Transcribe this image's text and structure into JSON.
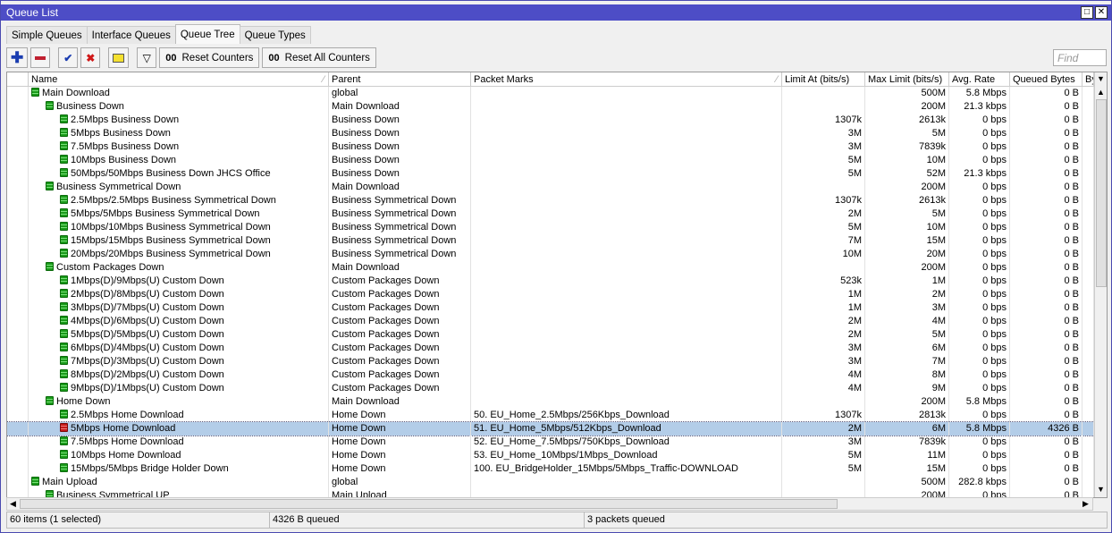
{
  "window": {
    "title": "Queue List",
    "buttons": [
      "restore",
      "close"
    ]
  },
  "tabs": [
    {
      "label": "Simple Queues"
    },
    {
      "label": "Interface Queues"
    },
    {
      "label": "Queue Tree",
      "active": true
    },
    {
      "label": "Queue Types"
    }
  ],
  "toolbar": {
    "reset_counters": "Reset Counters",
    "reset_all_counters": "Reset All Counters",
    "counter_glyph": "00",
    "find_placeholder": "Find"
  },
  "columns": [
    "Name",
    "Parent",
    "Packet Marks",
    "Limit At (bits/s)",
    "Max Limit (bits/s)",
    "Avg. Rate",
    "Queued Bytes",
    "By"
  ],
  "rows": [
    {
      "level": 0,
      "name": "Main Download",
      "parent": "global",
      "marks": "",
      "limit": "",
      "max": "500M",
      "avg": "5.8 Mbps",
      "queued": "0 B"
    },
    {
      "level": 1,
      "name": "Business Down",
      "parent": "Main Download",
      "marks": "",
      "limit": "",
      "max": "200M",
      "avg": "21.3 kbps",
      "queued": "0 B"
    },
    {
      "level": 2,
      "name": "2.5Mbps Business Down",
      "parent": "Business Down",
      "marks": "",
      "limit": "1307k",
      "max": "2613k",
      "avg": "0 bps",
      "queued": "0 B"
    },
    {
      "level": 2,
      "name": "5Mbps Business Down",
      "parent": "Business Down",
      "marks": "",
      "limit": "3M",
      "max": "5M",
      "avg": "0 bps",
      "queued": "0 B"
    },
    {
      "level": 2,
      "name": "7.5Mbps Business Down",
      "parent": "Business Down",
      "marks": "",
      "limit": "3M",
      "max": "7839k",
      "avg": "0 bps",
      "queued": "0 B"
    },
    {
      "level": 2,
      "name": "10Mbps Business Down",
      "parent": "Business Down",
      "marks": "",
      "limit": "5M",
      "max": "10M",
      "avg": "0 bps",
      "queued": "0 B"
    },
    {
      "level": 2,
      "name": "50Mbps/50Mbps Business Down JHCS Office",
      "parent": "Business Down",
      "marks": "",
      "limit": "5M",
      "max": "52M",
      "avg": "21.3 kbps",
      "queued": "0 B"
    },
    {
      "level": 1,
      "name": "Business Symmetrical Down",
      "parent": "Main Download",
      "marks": "",
      "limit": "",
      "max": "200M",
      "avg": "0 bps",
      "queued": "0 B"
    },
    {
      "level": 2,
      "name": "2.5Mbps/2.5Mbps Business Symmetrical Down",
      "parent": "Business Symmetrical Down",
      "marks": "",
      "limit": "1307k",
      "max": "2613k",
      "avg": "0 bps",
      "queued": "0 B"
    },
    {
      "level": 2,
      "name": "5Mbps/5Mbps Business Symmetrical Down",
      "parent": "Business Symmetrical Down",
      "marks": "",
      "limit": "2M",
      "max": "5M",
      "avg": "0 bps",
      "queued": "0 B"
    },
    {
      "level": 2,
      "name": "10Mbps/10Mbps  Business Symmetrical Down",
      "parent": "Business Symmetrical Down",
      "marks": "",
      "limit": "5M",
      "max": "10M",
      "avg": "0 bps",
      "queued": "0 B"
    },
    {
      "level": 2,
      "name": "15Mbps/15Mbps Business Symmetrical Down",
      "parent": "Business Symmetrical Down",
      "marks": "",
      "limit": "7M",
      "max": "15M",
      "avg": "0 bps",
      "queued": "0 B"
    },
    {
      "level": 2,
      "name": "20Mbps/20Mbps Business Symmetrical Down",
      "parent": "Business Symmetrical Down",
      "marks": "",
      "limit": "10M",
      "max": "20M",
      "avg": "0 bps",
      "queued": "0 B"
    },
    {
      "level": 1,
      "name": "Custom Packages Down",
      "parent": "Main Download",
      "marks": "",
      "limit": "",
      "max": "200M",
      "avg": "0 bps",
      "queued": "0 B"
    },
    {
      "level": 2,
      "name": "1Mbps(D)/9Mbps(U) Custom Down",
      "parent": "Custom Packages Down",
      "marks": "",
      "limit": "523k",
      "max": "1M",
      "avg": "0 bps",
      "queued": "0 B"
    },
    {
      "level": 2,
      "name": "2Mbps(D)/8Mbps(U) Custom Down",
      "parent": "Custom Packages Down",
      "marks": "",
      "limit": "1M",
      "max": "2M",
      "avg": "0 bps",
      "queued": "0 B"
    },
    {
      "level": 2,
      "name": "3Mbps(D)/7Mbps(U) Custom Down",
      "parent": "Custom Packages Down",
      "marks": "",
      "limit": "1M",
      "max": "3M",
      "avg": "0 bps",
      "queued": "0 B"
    },
    {
      "level": 2,
      "name": "4Mbps(D)/6Mbps(U) Custom Down",
      "parent": "Custom Packages Down",
      "marks": "",
      "limit": "2M",
      "max": "4M",
      "avg": "0 bps",
      "queued": "0 B"
    },
    {
      "level": 2,
      "name": "5Mbps(D)/5Mbps(U) Custom Down",
      "parent": "Custom Packages Down",
      "marks": "",
      "limit": "2M",
      "max": "5M",
      "avg": "0 bps",
      "queued": "0 B"
    },
    {
      "level": 2,
      "name": "6Mbps(D)/4Mbps(U) Custom Down",
      "parent": "Custom Packages Down",
      "marks": "",
      "limit": "3M",
      "max": "6M",
      "avg": "0 bps",
      "queued": "0 B"
    },
    {
      "level": 2,
      "name": "7Mbps(D)/3Mbps(U) Custom Down",
      "parent": "Custom Packages Down",
      "marks": "",
      "limit": "3M",
      "max": "7M",
      "avg": "0 bps",
      "queued": "0 B"
    },
    {
      "level": 2,
      "name": "8Mbps(D)/2Mbps(U) Custom Down",
      "parent": "Custom Packages Down",
      "marks": "",
      "limit": "4M",
      "max": "8M",
      "avg": "0 bps",
      "queued": "0 B"
    },
    {
      "level": 2,
      "name": "9Mbps(D)/1Mbps(U) Custom Down",
      "parent": "Custom Packages Down",
      "marks": "",
      "limit": "4M",
      "max": "9M",
      "avg": "0 bps",
      "queued": "0 B"
    },
    {
      "level": 1,
      "name": "Home Down",
      "parent": "Main Download",
      "marks": "",
      "limit": "",
      "max": "200M",
      "avg": "5.8 Mbps",
      "queued": "0 B"
    },
    {
      "level": 2,
      "name": "2.5Mbps Home Download",
      "parent": "Home Down",
      "marks": "50. EU_Home_2.5Mbps/256Kbps_Download",
      "limit": "1307k",
      "max": "2813k",
      "avg": "0 bps",
      "queued": "0 B"
    },
    {
      "level": 2,
      "name": "5Mbps Home Download",
      "parent": "Home Down",
      "marks": "51. EU_Home_5Mbps/512Kbps_Download",
      "limit": "2M",
      "max": "6M",
      "avg": "5.8 Mbps",
      "queued": "4326 B",
      "selected": true,
      "status": "red"
    },
    {
      "level": 2,
      "name": "7.5Mbps Home Download",
      "parent": "Home Down",
      "marks": "52. EU_Home_7.5Mbps/750Kbps_Download",
      "limit": "3M",
      "max": "7839k",
      "avg": "0 bps",
      "queued": "0 B"
    },
    {
      "level": 2,
      "name": "10Mbps Home Download",
      "parent": "Home Down",
      "marks": "53. EU_Home_10Mbps/1Mbps_Download",
      "limit": "5M",
      "max": "11M",
      "avg": "0 bps",
      "queued": "0 B"
    },
    {
      "level": 2,
      "name": "15Mbps/5Mbps Bridge Holder Down",
      "parent": "Home Down",
      "marks": "100. EU_BridgeHolder_15Mbps/5Mbps_Traffic-DOWNLOAD",
      "limit": "5M",
      "max": "15M",
      "avg": "0 bps",
      "queued": "0 B"
    },
    {
      "level": 0,
      "name": "Main Upload",
      "parent": "global",
      "marks": "",
      "limit": "",
      "max": "500M",
      "avg": "282.8 kbps",
      "queued": "0 B"
    },
    {
      "level": 1,
      "name": "Business Symmetrical UP",
      "parent": "Main Upload",
      "marks": "",
      "limit": "",
      "max": "200M",
      "avg": "0 bps",
      "queued": "0 B"
    }
  ],
  "status": {
    "items": "60 items (1 selected)",
    "queued": "4326 B queued",
    "packets": "3 packets queued"
  },
  "colors": {
    "title_bar": "#4d4dc6",
    "selected_row": "#b3cde8",
    "queue_ok": "#1a9a1a",
    "queue_busy": "#c41a1a"
  }
}
